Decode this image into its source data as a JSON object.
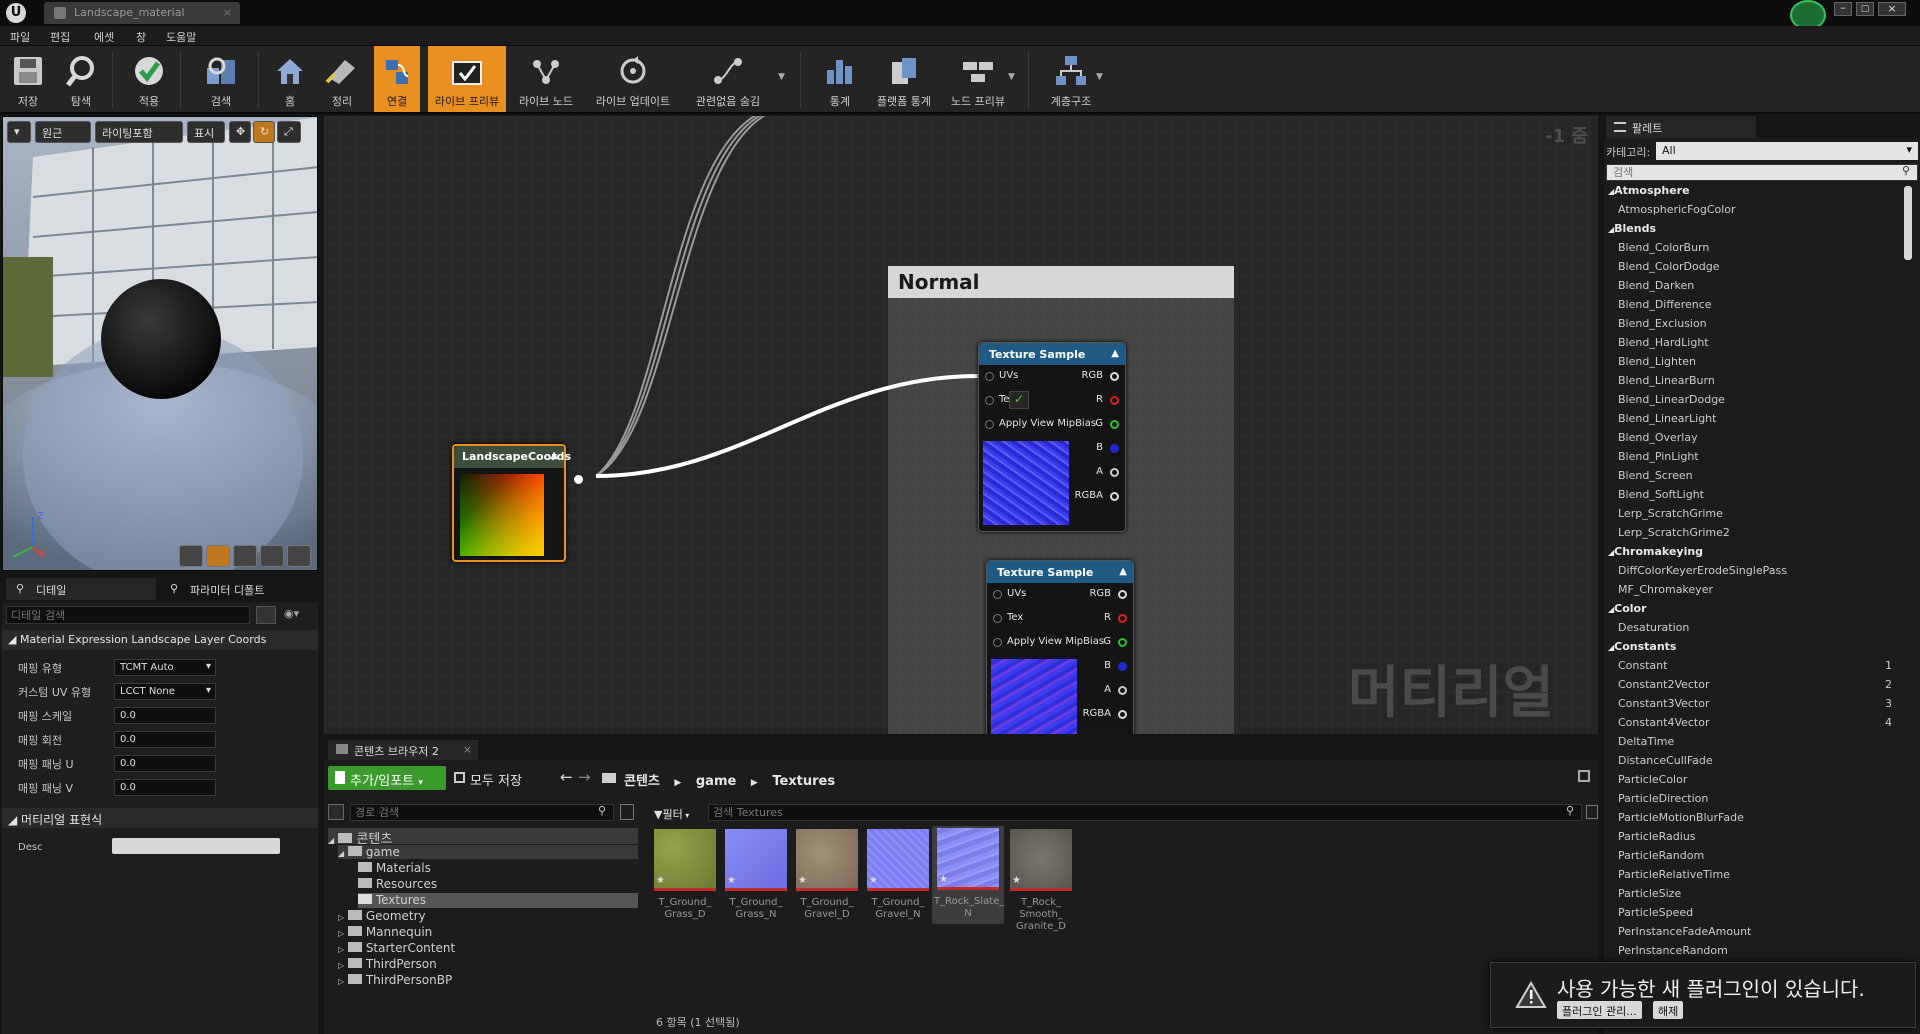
{
  "window": {
    "tab_title": "Landscape_material"
  },
  "menu": [
    "파일",
    "편집",
    "에셋",
    "창",
    "도움말"
  ],
  "toolbar": [
    {
      "label": "저장",
      "icon": "save-icon"
    },
    {
      "label": "탐색",
      "icon": "browse-icon"
    },
    {
      "label": "적용",
      "icon": "apply-icon"
    },
    {
      "label": "검색",
      "icon": "search-icon"
    },
    {
      "label": "홈",
      "icon": "home-icon"
    },
    {
      "label": "정리",
      "icon": "clean-up-icon"
    },
    {
      "label": "연결",
      "icon": "connectors-icon",
      "active": true
    },
    {
      "label": "라이브 프리뷰",
      "icon": "live-preview-icon",
      "active": true
    },
    {
      "label": "라이브 노드",
      "icon": "live-nodes-icon"
    },
    {
      "label": "라이브 업데이트",
      "icon": "live-update-icon"
    },
    {
      "label": "관련없음 숨김",
      "icon": "hide-unrelated-icon"
    },
    {
      "label": "통계",
      "icon": "stats-icon"
    },
    {
      "label": "플랫폼 통계",
      "icon": "platform-stats-icon"
    },
    {
      "label": "노드 프리뷰",
      "icon": "node-preview-icon"
    },
    {
      "label": "계층구조",
      "icon": "hierarchy-icon"
    }
  ],
  "viewport": {
    "buttons": [
      "원근",
      "라이팅포함",
      "표시"
    ],
    "axis_z": "Z",
    "axis_x": "X"
  },
  "details": {
    "tabs": [
      "디테일",
      "파라미터 디폴트"
    ],
    "search_placeholder": "디테일 검색",
    "section_title": "Material Expression Landscape Layer Coords",
    "properties": [
      {
        "label": "매핑 유형",
        "value": "TCMT Auto",
        "kind": "dropdown"
      },
      {
        "label": "커스텀 UV 유형",
        "value": "LCCT None",
        "kind": "dropdown"
      },
      {
        "label": "매핑 스케일",
        "value": "0.0",
        "kind": "number"
      },
      {
        "label": "매핑 회전",
        "value": "0.0",
        "kind": "number"
      },
      {
        "label": "매핑 패닝 U",
        "value": "0.0",
        "kind": "number"
      },
      {
        "label": "매핑 패닝 V",
        "value": "0.0",
        "kind": "number"
      }
    ],
    "section2_title": "머티리얼 표현식",
    "desc_label": "Desc"
  },
  "graph": {
    "zoom": "-1 줌",
    "watermark": "머티리얼",
    "comment_title": "Normal",
    "coords_node": {
      "title": "LandscapeCoords"
    },
    "tex1": {
      "title": "Texture Sample",
      "inputs": [
        "UVs",
        "Te",
        "Apply View MipBias"
      ],
      "outputs": [
        "RGB",
        "R",
        "G",
        "B",
        "A",
        "RGBA"
      ]
    },
    "tex2": {
      "title": "Texture Sample",
      "inputs": [
        "UVs",
        "Tex",
        "Apply View MipBias"
      ],
      "outputs": [
        "RGB",
        "R",
        "G",
        "B",
        "A",
        "RGBA"
      ]
    },
    "colors": {
      "accent": "#e88f20",
      "texture_head": "#1f5a85",
      "coords_head": "#3d4e3d"
    }
  },
  "content_browser": {
    "tab": "콘텐츠 브라우저 2",
    "add_import": "추가/임포트",
    "save_all": "모두 저장",
    "breadcrumb": [
      "콘텐츠",
      "game",
      "Textures"
    ],
    "path_search_placeholder": "경로 검색",
    "filter_label": "필터",
    "asset_search_placeholder": "검색 Textures",
    "folders": [
      {
        "name": "콘텐츠",
        "depth": 0
      },
      {
        "name": "game",
        "depth": 1
      },
      {
        "name": "Materials",
        "depth": 2
      },
      {
        "name": "Resources",
        "depth": 2
      },
      {
        "name": "Textures",
        "depth": 2,
        "selected": true
      },
      {
        "name": "Geometry",
        "depth": 1
      },
      {
        "name": "Mannequin",
        "depth": 1
      },
      {
        "name": "StarterContent",
        "depth": 1
      },
      {
        "name": "ThirdPerson",
        "depth": 1
      },
      {
        "name": "ThirdPersonBP",
        "depth": 1
      }
    ],
    "assets": [
      {
        "name": "T_Ground_ Grass_D",
        "line1": "T_Ground_",
        "line2": "Grass_D",
        "line3": "",
        "color": "#7a8a3a"
      },
      {
        "name": "T_Ground_ Grass_N",
        "line1": "T_Ground_",
        "line2": "Grass_N",
        "line3": "",
        "color": "#7b7fe8"
      },
      {
        "name": "T_Ground_ Gravel_D",
        "line1": "T_Ground_",
        "line2": "Gravel_D",
        "line3": "",
        "color": "#8a7a66"
      },
      {
        "name": "T_Ground_ Gravel_N",
        "line1": "T_Ground_",
        "line2": "Gravel_N",
        "line3": "",
        "color": "#7c7ee0"
      },
      {
        "name": "T_Rock_Slate_ N",
        "line1": "T_Rock_Slate_",
        "line2": "N",
        "line3": "",
        "color": "#8a8ae8",
        "selected": true
      },
      {
        "name": "T_Rock_ Smooth_ Granite_D",
        "line1": "T_Rock_",
        "line2": "Smooth_",
        "line3": "Granite_D",
        "color": "#6e6a64"
      }
    ],
    "status": "6 항목 (1 선택됨)"
  },
  "palette": {
    "tab": "팔레트",
    "category_label": "카테고리:",
    "category_value": "All",
    "search_placeholder": "검색",
    "items": [
      {
        "text": "Atmosphere",
        "cat": true
      },
      {
        "text": "AtmosphericFogColor"
      },
      {
        "text": "Blends",
        "cat": true
      },
      {
        "text": "Blend_ColorBurn"
      },
      {
        "text": "Blend_ColorDodge"
      },
      {
        "text": "Blend_Darken"
      },
      {
        "text": "Blend_Difference"
      },
      {
        "text": "Blend_Exclusion"
      },
      {
        "text": "Blend_HardLight"
      },
      {
        "text": "Blend_Lighten"
      },
      {
        "text": "Blend_LinearBurn"
      },
      {
        "text": "Blend_LinearDodge"
      },
      {
        "text": "Blend_LinearLight"
      },
      {
        "text": "Blend_Overlay"
      },
      {
        "text": "Blend_PinLight"
      },
      {
        "text": "Blend_Screen"
      },
      {
        "text": "Blend_SoftLight"
      },
      {
        "text": "Lerp_ScratchGrime"
      },
      {
        "text": "Lerp_ScratchGrime2"
      },
      {
        "text": "Chromakeying",
        "cat": true
      },
      {
        "text": "DiffColorKeyerErodeSinglePass"
      },
      {
        "text": "MF_Chromakeyer"
      },
      {
        "text": "Color",
        "cat": true
      },
      {
        "text": "Desaturation"
      },
      {
        "text": "Constants",
        "cat": true
      },
      {
        "text": "Constant",
        "key": "1"
      },
      {
        "text": "Constant2Vector",
        "key": "2"
      },
      {
        "text": "Constant3Vector",
        "key": "3"
      },
      {
        "text": "Constant4Vector",
        "key": "4"
      },
      {
        "text": "DeltaTime"
      },
      {
        "text": "DistanceCullFade"
      },
      {
        "text": "ParticleColor"
      },
      {
        "text": "ParticleDirection"
      },
      {
        "text": "ParticleMotionBlurFade"
      },
      {
        "text": "ParticleRadius"
      },
      {
        "text": "ParticleRandom"
      },
      {
        "text": "ParticleRelativeTime"
      },
      {
        "text": "ParticleSize"
      },
      {
        "text": "ParticleSpeed"
      },
      {
        "text": "PerInstanceFadeAmount"
      },
      {
        "text": "PerInstanceRandom"
      }
    ]
  },
  "notification": {
    "message": "사용 가능한 새 플러그인이 있습니다.",
    "manage_button": "플러그인 관리...",
    "dismiss_button": "해제"
  }
}
